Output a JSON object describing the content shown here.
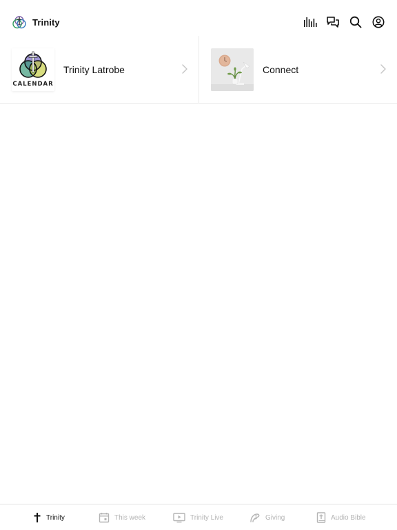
{
  "app": {
    "title": "Trinity"
  },
  "header": {
    "actions": [
      {
        "icon": "audio-bars-icon"
      },
      {
        "icon": "chat-bubbles-icon"
      },
      {
        "icon": "search-icon"
      },
      {
        "icon": "account-icon"
      }
    ]
  },
  "cards": [
    {
      "title": "Trinity Latrobe",
      "thumb_text": "CALENDAR"
    },
    {
      "title": "Connect"
    }
  ],
  "tabbar": {
    "tabs": [
      {
        "label": "Trinity",
        "icon": "cross-icon",
        "active": true
      },
      {
        "label": "This week",
        "icon": "calendar-icon",
        "active": false
      },
      {
        "label": "Trinity Live",
        "icon": "tv-play-icon",
        "active": false
      },
      {
        "label": "Giving",
        "icon": "giving-icon",
        "active": false
      },
      {
        "label": "Audio Bible",
        "icon": "bible-icon",
        "active": false
      }
    ]
  },
  "colors": {
    "active": "#111111",
    "inactive": "#b4b4b4",
    "divider": "#e7e7e7"
  }
}
